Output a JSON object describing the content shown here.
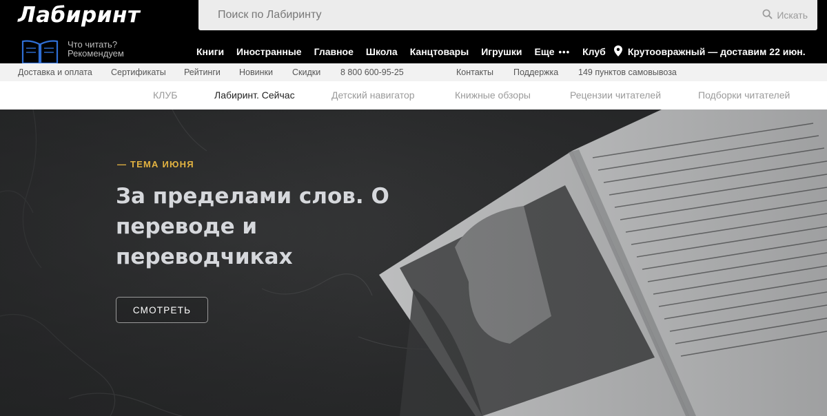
{
  "header": {
    "logo": "Лабиринт",
    "search_placeholder": "Поиск по Лабиринту",
    "search_button": "Искать",
    "recommend_line1": "Что читать?",
    "recommend_line2": "Рекомендуем",
    "nav": [
      "Книги",
      "Иностранные",
      "Главное",
      "Школа",
      "Канцтовары",
      "Игрушки"
    ],
    "more_label": "Еще",
    "more_dots": "•••",
    "club": "Клуб",
    "delivery": "Крутоовражный — доставим 22 июн."
  },
  "service_bar": {
    "delivery_payment": "Доставка и оплата",
    "certificates": "Сертификаты",
    "ratings": "Рейтинги",
    "new": "Новинки",
    "discounts": "Скидки",
    "phone": "8 800 600-95-25",
    "contacts": "Контакты",
    "support": "Поддержка",
    "pickup": "149 пунктов самовывоза"
  },
  "club_nav": {
    "club": "КЛУБ",
    "now": "Лабиринт. Сейчас",
    "kids": "Детский навигатор",
    "reviews_books": "Книжные обзоры",
    "reader_reviews": "Рецензии читателей",
    "collections": "Подборки читателей"
  },
  "hero": {
    "tag": "— ТЕМА ИЮНЯ",
    "title": "За пределами слов. О переводе и переводчиках",
    "button": "СМОТРЕТЬ"
  },
  "colors": {
    "accent_gold": "#e3b341",
    "header_bg": "#000000",
    "service_bg": "#f2f2f2"
  }
}
